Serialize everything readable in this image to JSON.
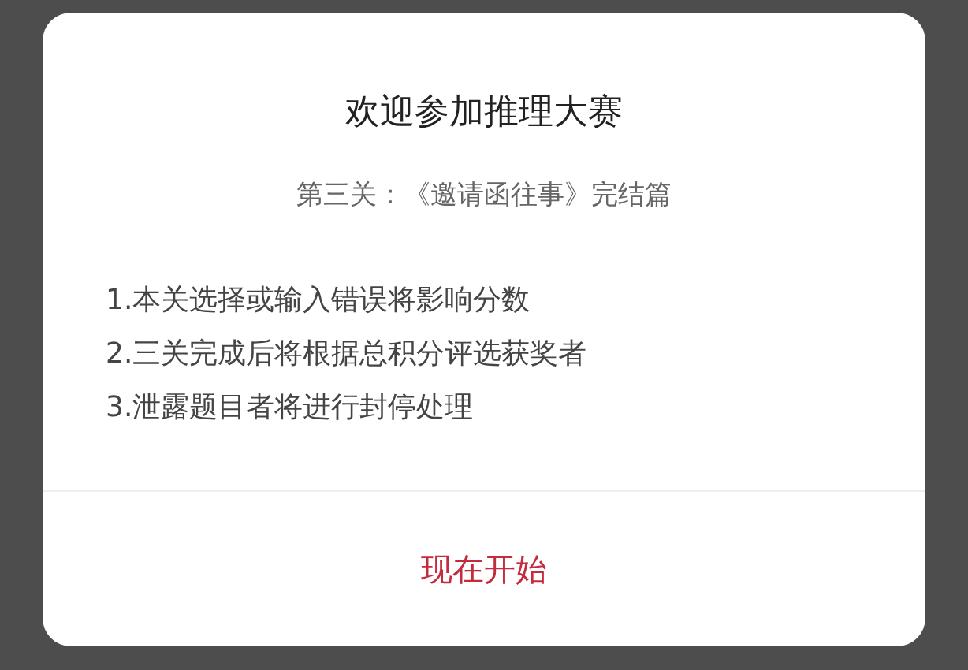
{
  "dialog": {
    "title": "欢迎参加推理大赛",
    "subtitle": "第三关：《邀请函往事》完结篇",
    "rules": [
      "1.本关选择或输入错误将影响分数",
      "2.三关完成后将根据总积分评选获奖者",
      "3.泄露题目者将进行封停处理"
    ],
    "button": "现在开始"
  }
}
